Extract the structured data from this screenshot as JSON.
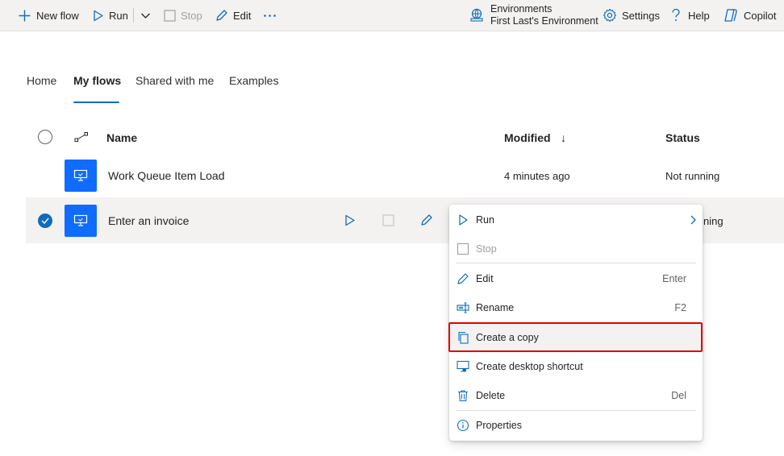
{
  "toolbar": {
    "new_flow": "New flow",
    "run": "Run",
    "stop": "Stop",
    "edit": "Edit",
    "env_label": "Environments",
    "env_name": "First Last's Environment",
    "settings": "Settings",
    "help": "Help",
    "copilot": "Copilot"
  },
  "tabs": [
    "Home",
    "My flows",
    "Shared with me",
    "Examples"
  ],
  "active_tab": "My flows",
  "table": {
    "headers": {
      "name": "Name",
      "modified": "Modified",
      "status": "Status"
    },
    "sort_indicator": "↓",
    "rows": [
      {
        "name": "Work Queue Item Load",
        "modified": "4 minutes ago",
        "status": "Not running",
        "selected": false
      },
      {
        "name": "Enter an invoice",
        "status_partial": "ning",
        "selected": true
      }
    ]
  },
  "context_menu": {
    "items": [
      {
        "label": "Run",
        "shortcut": "",
        "icon": "play-icon",
        "submenu": true
      },
      {
        "label": "Stop",
        "shortcut": "",
        "icon": "stop-icon",
        "disabled": true
      },
      {
        "label": "Edit",
        "shortcut": "Enter",
        "icon": "pencil-icon"
      },
      {
        "label": "Rename",
        "shortcut": "F2",
        "icon": "rename-icon"
      },
      {
        "label": "Create a copy",
        "shortcut": "",
        "icon": "copy-icon",
        "highlighted": true
      },
      {
        "label": "Create desktop shortcut",
        "shortcut": "",
        "icon": "desktop-shortcut-icon"
      },
      {
        "label": "Delete",
        "shortcut": "Del",
        "icon": "trash-icon"
      },
      {
        "label": "Properties",
        "shortcut": "",
        "icon": "info-icon"
      }
    ]
  },
  "colors": {
    "accent": "#0f6cbd",
    "flow_icon_bg": "#0f6cff",
    "highlight_border": "#e00000",
    "toolbar_bg": "#f3f2f1"
  }
}
